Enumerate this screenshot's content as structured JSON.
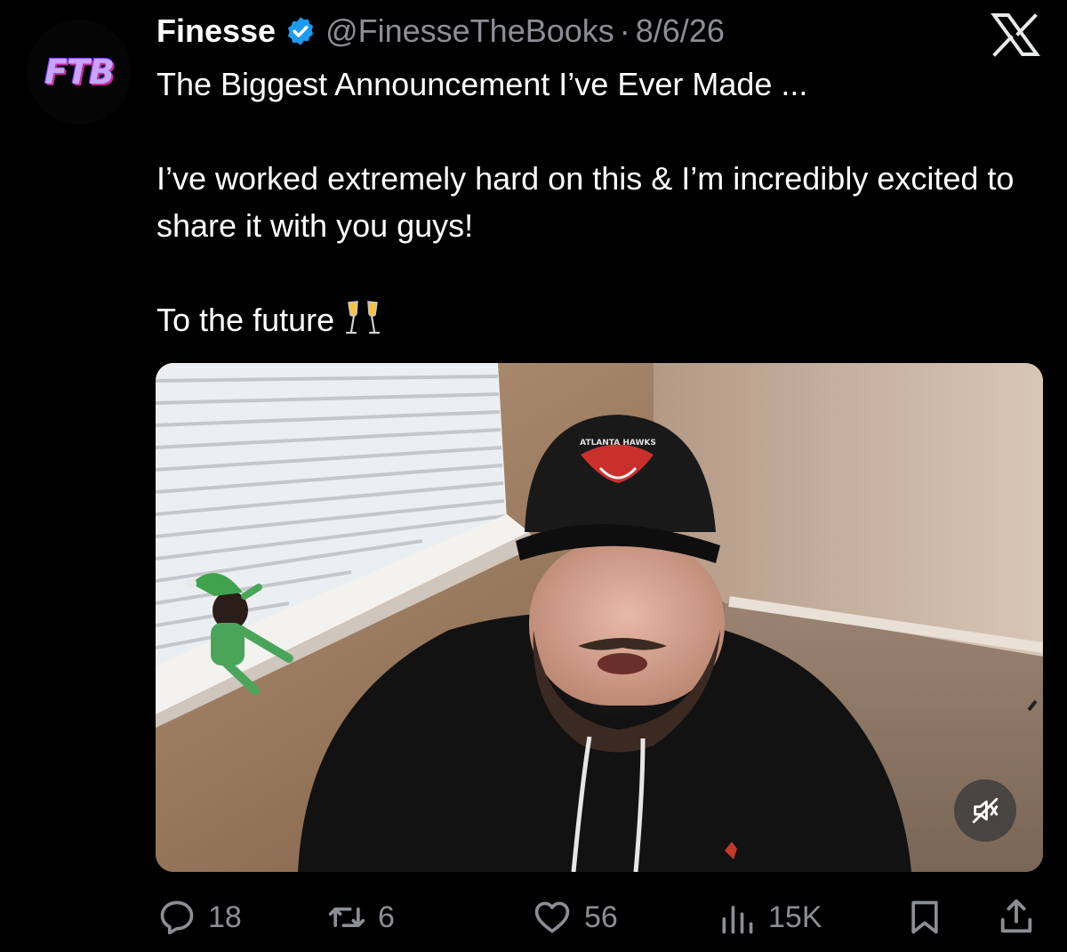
{
  "account": {
    "avatar_text": "FTB",
    "name": "Finesse",
    "handle": "@FinesseTheBooks",
    "date": "8/6/26"
  },
  "post": {
    "line1": "The Biggest Announcement I’ve Ever Made ...",
    "line2": "I’ve worked extremely hard on this & I’m incredibly excited to share it with you guys!",
    "line3": "To the future"
  },
  "media": {
    "type": "video",
    "muted": true,
    "cap_text": "ATLANTA HAWKS"
  },
  "actions": {
    "replies": "18",
    "reposts": "6",
    "likes": "56",
    "views": "15K"
  },
  "colors": {
    "background": "#000000",
    "text": "#ffffff",
    "secondary": "#8b8f94",
    "verified": "#1d9bf0"
  },
  "icons": [
    "verified-badge-icon",
    "x-logo-icon",
    "mute-icon",
    "reply-icon",
    "repost-icon",
    "like-icon",
    "views-icon",
    "bookmark-icon",
    "share-icon",
    "champagne-icon"
  ]
}
